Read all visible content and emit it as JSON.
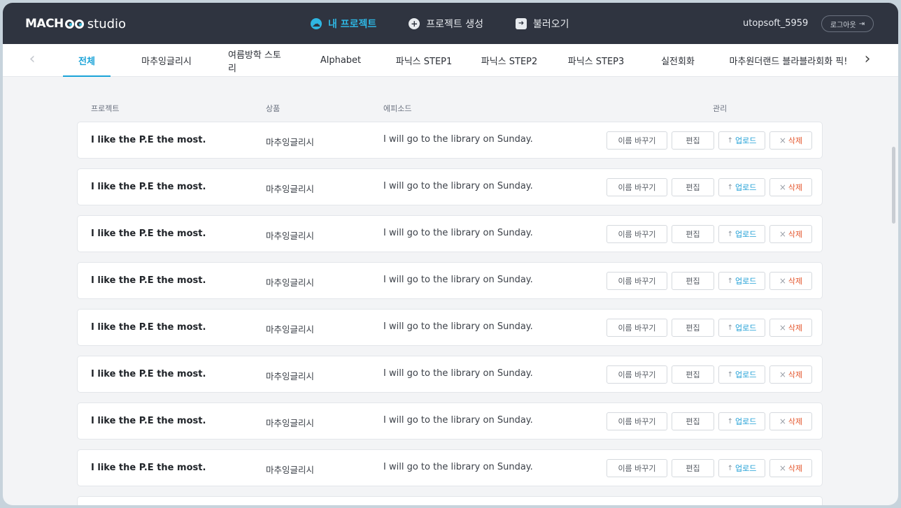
{
  "header": {
    "logo_mach": "MACH",
    "logo_studio": "studio",
    "nav": [
      {
        "label": "내 프로젝트",
        "icon": "cloud-icon",
        "active": true
      },
      {
        "label": "프로젝트 생성",
        "icon": "plus-circle-icon",
        "active": false
      },
      {
        "label": "불러오기",
        "icon": "import-arrow-icon",
        "active": false
      }
    ],
    "username": "utopsoft_5959",
    "logout_label": "로그아웃"
  },
  "tabs": [
    {
      "label": "전체",
      "active": true
    },
    {
      "label": "마추잉글리시"
    },
    {
      "label": "여름방학 스토리"
    },
    {
      "label": "Alphabet"
    },
    {
      "label": "파닉스 STEP1"
    },
    {
      "label": "파닉스 STEP2"
    },
    {
      "label": "파닉스 STEP3"
    },
    {
      "label": "실전회화"
    },
    {
      "label": "마추원더랜드 블라블라회화 픽!"
    }
  ],
  "table": {
    "headers": {
      "project": "프로젝트",
      "product": "상품",
      "episode": "에피소드",
      "manage": "관리"
    },
    "actions": {
      "rename": "이름 바꾸기",
      "edit": "편집",
      "upload": "업로드",
      "delete": "삭제"
    },
    "rows": [
      {
        "project": "I like the P.E the most.",
        "product": "마추잉글리시",
        "episode": "I will go to the library on Sunday."
      },
      {
        "project": "I like the P.E the most.",
        "product": "마추잉글리시",
        "episode": "I will go to the library on Sunday."
      },
      {
        "project": "I like the P.E the most.",
        "product": "마추잉글리시",
        "episode": "I will go to the library on Sunday."
      },
      {
        "project": "I like the P.E the most.",
        "product": "마추잉글리시",
        "episode": "I will go to the library on Sunday."
      },
      {
        "project": "I like the P.E the most.",
        "product": "마추잉글리시",
        "episode": "I will go to the library on Sunday."
      },
      {
        "project": "I like the P.E the most.",
        "product": "마추잉글리시",
        "episode": "I will go to the library on Sunday."
      },
      {
        "project": "I like the P.E the most.",
        "product": "마추잉글리시",
        "episode": "I will go to the library on Sunday."
      },
      {
        "project": "I like the P.E the most.",
        "product": "마추잉글리시",
        "episode": "I will go to the library on Sunday."
      }
    ]
  },
  "colors": {
    "accent": "#1aa3d8",
    "header_bg": "#2f3440",
    "delete": "#e4572e"
  }
}
